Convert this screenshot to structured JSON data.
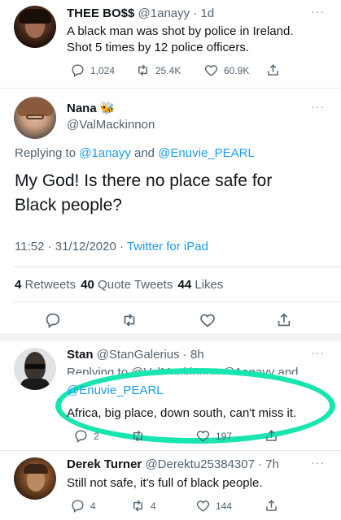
{
  "tweet1": {
    "name": "THEE BO$$",
    "handle": "@1anayy",
    "time": "· 1d",
    "text_line1": "A black man was shot by police in Ireland.",
    "text_line2": "Shot 5 times by 12 police officers.",
    "replies": "1,024",
    "retweets": "25.4K",
    "likes": "60.9K",
    "more": "···"
  },
  "tweet2": {
    "name": "Nana",
    "name_emoji": "🐝",
    "handle": "@ValMackinnon",
    "replying_prefix": "Replying to ",
    "replying_user1": "@1anayy",
    "replying_and": " and ",
    "replying_user2": "@Enuvie_PEARL",
    "text_line1": "My God!  Is there no place safe for",
    "text_line2": "Black people?",
    "time": "11:52 · 31/12/2020 · ",
    "source": "Twitter for iPad",
    "retweet_count": "4",
    "retweet_label": " Retweets",
    "quote_count": "40",
    "quote_label": " Quote Tweets",
    "like_count": "44",
    "like_label": " Likes",
    "more": "···"
  },
  "tweet3": {
    "name": "Stan",
    "handle": "@StanGalerius",
    "time": "· 8h",
    "replying_partial": "Replying to @ValMackinnon @1anayy and",
    "mention": "@Enuvie_PEARL",
    "text": "Africa, big place, down south, can't miss it.",
    "replies": "2",
    "likes": "197",
    "more": "···"
  },
  "tweet4": {
    "name": "Derek Turner",
    "handle": "@Derektu25384307",
    "time": "· 7h",
    "text": "Still not safe, it's full of black people.",
    "replies": "4",
    "retweets": "4",
    "likes": "144",
    "more": "···"
  },
  "colors": {
    "accent": "#1d9bf0",
    "highlight": "#19e5b0",
    "text": "#0f1419",
    "muted": "#536471"
  }
}
